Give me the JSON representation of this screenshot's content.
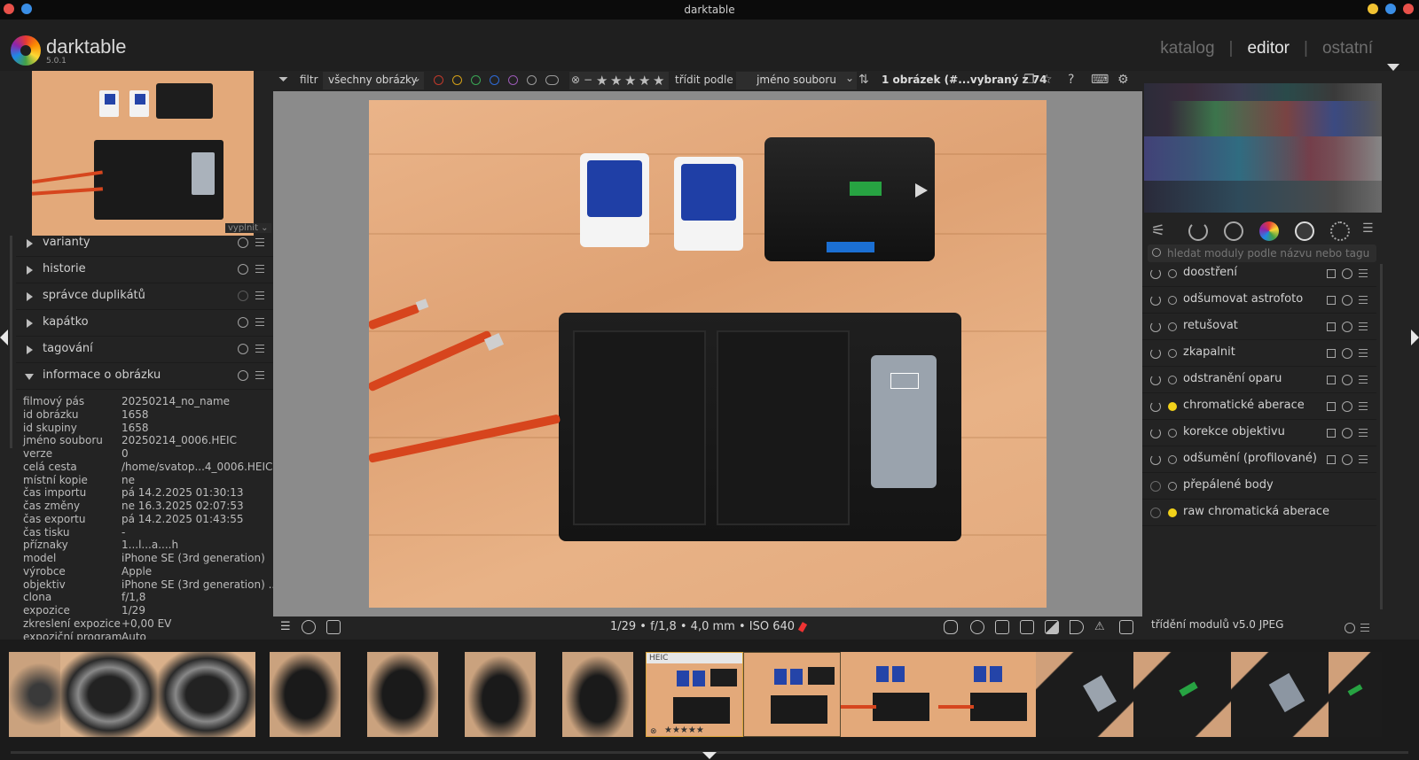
{
  "window": {
    "title": "darktable"
  },
  "header": {
    "app_name": "darktable",
    "version": "5.0.1",
    "views": [
      {
        "label": "katalog",
        "active": false
      },
      {
        "label": "editor",
        "active": true
      },
      {
        "label": "ostatní",
        "active": false
      }
    ],
    "separator": "|"
  },
  "toolbar": {
    "filter_label": "filtr",
    "filter_value": "všechny obrázky",
    "sort_label": "třídit podle",
    "sort_value": "jméno souboru",
    "count_prefix": "1 obrázek (#...vybraný z ",
    "count_total": "74",
    "color_labels": [
      "#c0392b",
      "#d4a017",
      "#3aa655",
      "#2e6bd8",
      "#9b59b6"
    ],
    "star_rating": 5
  },
  "navigation": {
    "mode_label": "vyplnit"
  },
  "left_modules": [
    {
      "label": "varianty",
      "expanded": false
    },
    {
      "label": "historie",
      "expanded": false
    },
    {
      "label": "správce duplikátů",
      "expanded": false
    },
    {
      "label": "kapátko",
      "expanded": false
    },
    {
      "label": "tagování",
      "expanded": false
    },
    {
      "label": "informace o obrázku",
      "expanded": true
    }
  ],
  "image_info": [
    {
      "key": "filmový pás",
      "value": "20250214_no_name"
    },
    {
      "key": "id obrázku",
      "value": "1658"
    },
    {
      "key": "id skupiny",
      "value": "1658"
    },
    {
      "key": "jméno souboru",
      "value": "20250214_0006.HEIC"
    },
    {
      "key": "verze",
      "value": "0"
    },
    {
      "key": "celá cesta",
      "value": "/home/svatop...4_0006.HEIC"
    },
    {
      "key": "místní kopie",
      "value": "ne"
    },
    {
      "key": "čas importu",
      "value": "pá 14.2.2025 01:30:13"
    },
    {
      "key": "čas změny",
      "value": "ne 16.3.2025 02:07:53"
    },
    {
      "key": "čas exportu",
      "value": "pá 14.2.2025 01:43:55"
    },
    {
      "key": "čas tisku",
      "value": "-"
    },
    {
      "key": "příznaky",
      "value": "1...l...a....h"
    },
    {
      "key": "model",
      "value": "iPhone SE (3rd generation)"
    },
    {
      "key": "výrobce",
      "value": "Apple"
    },
    {
      "key": "objektiv",
      "value": "iPhone SE (3rd generation) ..."
    },
    {
      "key": "clona",
      "value": "f/1,8"
    },
    {
      "key": "expozice",
      "value": "1/29"
    },
    {
      "key": "zkreslení expozice",
      "value": "+0,00 EV"
    },
    {
      "key": "expoziční program",
      "value": "Auto"
    }
  ],
  "bottom_toolbar": {
    "exif_summary": "1/29 • f/1,8 • 4,0 mm • ISO 640"
  },
  "right_panel": {
    "search_placeholder": "hledat moduly podle názvu nebo tagu",
    "modules": [
      {
        "label": "doostření",
        "enabled": true,
        "icon": "normal"
      },
      {
        "label": "odšumovat astrofoto",
        "enabled": true,
        "icon": "normal"
      },
      {
        "label": "retušovat",
        "enabled": true,
        "icon": "normal"
      },
      {
        "label": "zkapalnit",
        "enabled": true,
        "icon": "normal"
      },
      {
        "label": "odstranění oparu",
        "enabled": true,
        "icon": "normal"
      },
      {
        "label": "chromatické aberace",
        "enabled": true,
        "icon": "yellow"
      },
      {
        "label": "korekce objektivu",
        "enabled": true,
        "icon": "normal"
      },
      {
        "label": "odšumění (profilované)",
        "enabled": true,
        "icon": "normal"
      },
      {
        "label": "přepálené body",
        "enabled": false,
        "icon": "normal"
      },
      {
        "label": "raw chromatická aberace",
        "enabled": false,
        "icon": "yellow"
      }
    ],
    "sort_label": "třídění modulů  v5.0 JPEG"
  },
  "filmstrip": {
    "selected_label": "HEIC",
    "selected_stars": "★★★★★",
    "thumbs": [
      {
        "tone": "lens"
      },
      {
        "tone": "lens"
      },
      {
        "tone": "lens"
      },
      {
        "tone": "camera"
      },
      {
        "tone": "camera"
      },
      {
        "tone": "camera"
      },
      {
        "tone": "camera"
      },
      {
        "tone": "charger-selected"
      },
      {
        "tone": "charger"
      },
      {
        "tone": "charger"
      },
      {
        "tone": "charger"
      },
      {
        "tone": "dark"
      },
      {
        "tone": "dark"
      },
      {
        "tone": "dark"
      },
      {
        "tone": "dark"
      }
    ]
  }
}
